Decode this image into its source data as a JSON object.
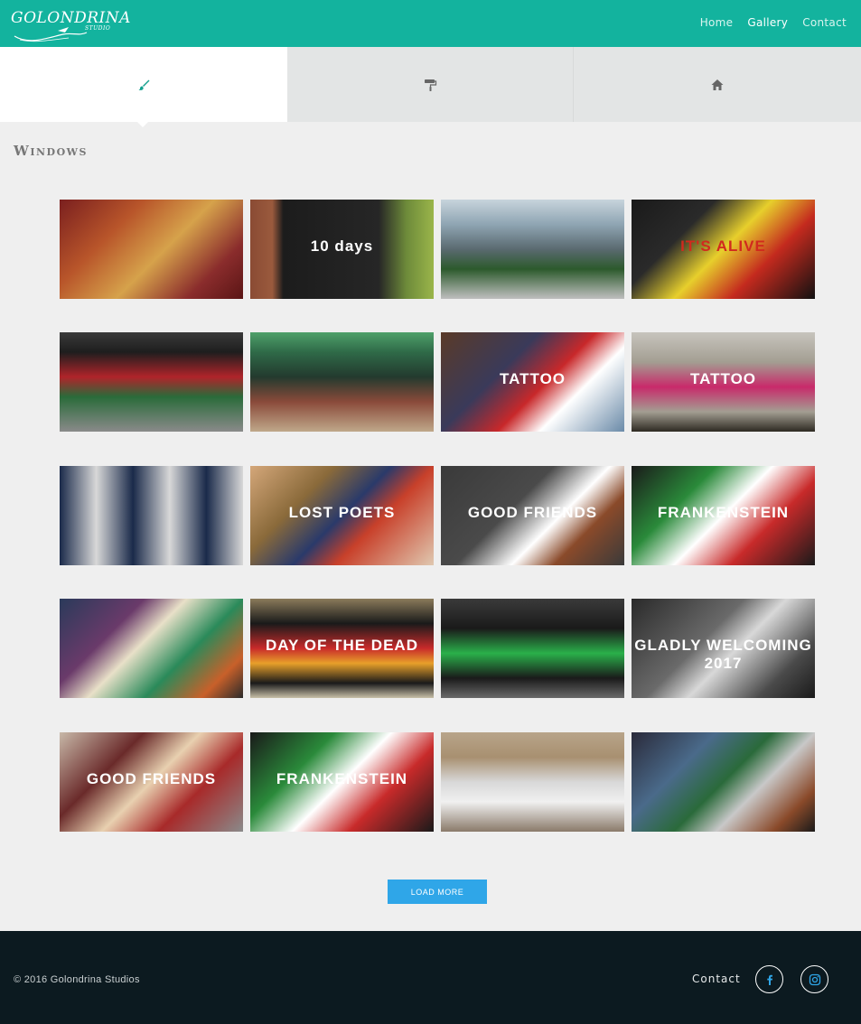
{
  "header": {
    "logo_text": "GOLONDRINA",
    "logo_sub": "STUDIO",
    "nav": [
      {
        "label": "Home",
        "active": false
      },
      {
        "label": "Gallery",
        "active": true
      },
      {
        "label": "Contact",
        "active": false
      }
    ],
    "bg_color": "#13b39e"
  },
  "tabs": [
    {
      "icon": "paintbrush-icon",
      "active": true
    },
    {
      "icon": "paint-roller-icon",
      "active": false
    },
    {
      "icon": "home-icon",
      "active": false
    }
  ],
  "section": {
    "title": "Windows"
  },
  "gallery": {
    "images": [
      {
        "label": "",
        "bg": "linear-gradient(135deg,#7a1f1f 0%,#b8552a 30%,#d6a24b 55%,#8a2c2c 80%,#5a1515 100%)",
        "fg": "#e8c07a"
      },
      {
        "label": "10 days",
        "bg": "linear-gradient(90deg,#8a4b34 0%,#9a5a3d 12%,#1c1c1c 18%,#262626 70%,#6d8a3a 85%,#9ab54a 100%)",
        "fg": "#ffffff"
      },
      {
        "label": "",
        "bg": "linear-gradient(180deg,#c7d4dc 0%,#8fa5b3 25%,#5a6a70 50%,#2c5a2c 70%,#bfbfbf 100%)",
        "fg": "#e04040"
      },
      {
        "label": "IT'S ALIVE",
        "bg": "linear-gradient(135deg,#1a1a1a 0%,#2a2a2a 30%,#e7cf2c 50%,#c42a1e 70%,#111111 100%)",
        "fg": "#d12a1e"
      },
      {
        "label": "",
        "bg": "linear-gradient(180deg,#3a3a3a 0%,#1e1e1e 20%,#b0242a 45%,#2a6b3a 65%,#8a8a8a 100%)",
        "fg": "#ffffff"
      },
      {
        "label": "",
        "bg": "linear-gradient(180deg,#4fa06a 0%,#2f6a48 20%,#233a2e 45%,#8a4a3a 70%,#bfa88a 100%)",
        "fg": "#ffffff"
      },
      {
        "label": "TATTOO",
        "bg": "linear-gradient(135deg,#5a3a28 0%,#3a3a5a 35%,#c8282a 55%,#ffffff 70%,#6a8aa8 100%)",
        "fg": "#ffffff"
      },
      {
        "label": "TATTOO",
        "bg": "linear-gradient(180deg,#c7c4bd 0%,#a39e92 30%,#c82a6a 55%,#a39e92 80%,#2e2a22 100%)",
        "fg": "#ffffff"
      },
      {
        "label": "",
        "bg": "linear-gradient(90deg,#1a2a4a 0%,#d8d8d8 20%,#1a2a4a 40%,#d8d8d8 60%,#1a2a4a 80%,#d8d8d8 100%)",
        "fg": "#ffffff"
      },
      {
        "label": "LOST POETS",
        "bg": "linear-gradient(135deg,#d4a77a 0%,#8a6a3a 30%,#2a3a6a 50%,#c8402a 65%,#e0c8b0 100%)",
        "fg": "#ffffff"
      },
      {
        "label": "GOOD FRIENDS",
        "bg": "linear-gradient(135deg,#3a3a3a 0%,#4a4a4a 40%,#ffffff 60%,#8a4a2a 75%,#3a3a3a 100%)",
        "fg": "#ffffff"
      },
      {
        "label": "FRANKENSTEIN",
        "bg": "linear-gradient(135deg,#1a1a1a 0%,#2a8a3a 30%,#ffffff 50%,#c82a2a 70%,#1a1a1a 100%)",
        "fg": "#ffffff"
      },
      {
        "label": "",
        "bg": "linear-gradient(135deg,#2a3a5a 0%,#6a3a6a 30%,#e8e0c8 45%,#2a8a5a 65%,#c8602a 85%,#2a2a2a 100%)",
        "fg": "#ffffff"
      },
      {
        "label": "DAY OF THE DEAD",
        "bg": "linear-gradient(180deg,#8a7a5a 0%,#1a1a1a 25%,#c82a2a 50%,#e8a02a 65%,#1a1a1a 85%,#c8c0a8 100%)",
        "fg": "#ffffff"
      },
      {
        "label": "",
        "bg": "linear-gradient(180deg,#3a3a3a 0%,#1a1a1a 30%,#2ab04a 55%,#1a1a1a 80%,#6a6a6a 100%)",
        "fg": "#ffffff"
      },
      {
        "label": "GLADLY WELCOMING 2017",
        "bg": "linear-gradient(135deg,#2a2a2a 0%,#6a6a6a 40%,#d8d8d8 55%,#4a4a4a 80%,#1a1a1a 100%)",
        "fg": "#ffffff"
      },
      {
        "label": "GOOD FRIENDS",
        "bg": "linear-gradient(135deg,#c8b8a8 0%,#6a2a2a 30%,#e8d0b0 50%,#a82a2a 70%,#8a8a8a 100%)",
        "fg": "#ffffff"
      },
      {
        "label": "FRANKENSTEIN",
        "bg": "linear-gradient(135deg,#1a1a1a 0%,#2a8a3a 30%,#ffffff 50%,#c82a2a 70%,#1a1a1a 100%)",
        "fg": "#ffffff"
      },
      {
        "label": "",
        "bg": "linear-gradient(180deg,#b8a48a 0%,#a89070 25%,#d8d8d8 50%,#f0f0f0 70%,#8a7a6a 100%)",
        "fg": "#ffffff"
      },
      {
        "label": "",
        "bg": "linear-gradient(135deg,#2a2a3a 0%,#4a6a8a 30%,#2a6a3a 50%,#c8c8c8 65%,#8a4a2a 85%,#1a1a1a 100%)",
        "fg": "#ffffff"
      }
    ]
  },
  "load_more_label": "LOAD MORE",
  "footer": {
    "copyright": "© 2016 Golondrina Studios",
    "contact": "Contact",
    "social": [
      {
        "icon": "facebook-icon",
        "glyph": "f"
      },
      {
        "icon": "instagram-icon",
        "glyph": ""
      }
    ],
    "accent": "#2fa6e8"
  }
}
